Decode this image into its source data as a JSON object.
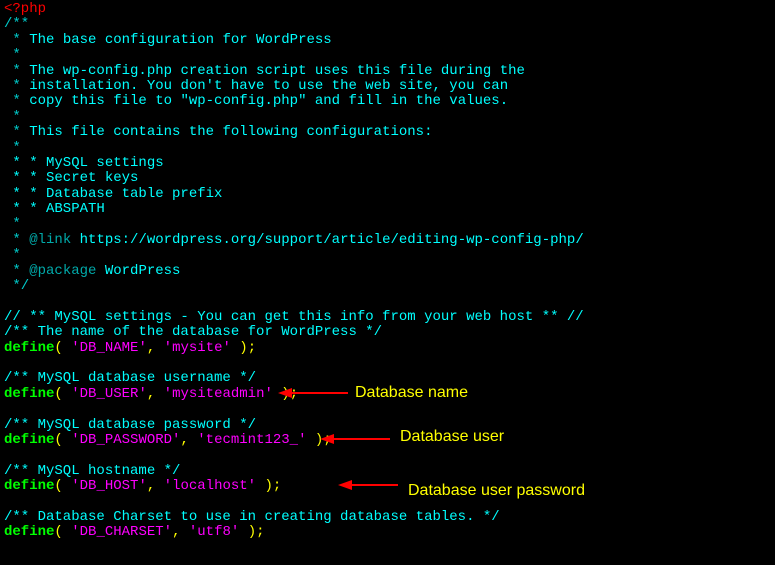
{
  "code": {
    "php_open": "<?php",
    "c_open": "/**",
    "c_star": " *",
    "c_l1a": " * ",
    "c_l1b": "The base configuration for WordPress",
    "c_l2b": "The wp-config.php creation script uses this file during the",
    "c_l3b": "installation. You don't have to use the web site, you can",
    "c_l4b": "copy this file to \"wp-config.php\" and fill in the values.",
    "c_l5b": "This file contains the following configurations:",
    "c_li1": " * * MySQL settings",
    "c_li2": " * * Secret keys",
    "c_li3": " * * Database table prefix",
    "c_li4": " * * ABSPATH",
    "tag_link": "@link",
    "link_url": " https://wordpress.org/support/article/editing-wp-config-php/",
    "tag_pkg": "@package",
    "pkg_name": " WordPress",
    "c_close": " */",
    "mysql_intro": "// ** MySQL settings - You can get this info from your web host ** //",
    "db_name_c": "/** The name of the database for WordPress */",
    "db_user_c": "/** MySQL database username */",
    "db_pass_c": "/** MySQL database password */",
    "db_host_c": "/** MySQL hostname */",
    "db_char_c": "/** Database Charset to use in creating database tables. */",
    "define": "define",
    "paren_o": "( ",
    "sep": ", ",
    "paren_c": " )",
    "semi": ";",
    "k_name": "'DB_NAME'",
    "v_name": "'mysite'",
    "k_user": "'DB_USER'",
    "v_user": "'mysiteadmin'",
    "k_pass": "'DB_PASSWORD'",
    "v_pass": "'tecmint123_'",
    "k_host": "'DB_HOST'",
    "v_host": "'localhost'",
    "k_char": "'DB_CHARSET'",
    "v_char": "'utf8'"
  },
  "annotations": {
    "a1": "Database name",
    "a2": "Database user",
    "a3": "Database user password"
  }
}
